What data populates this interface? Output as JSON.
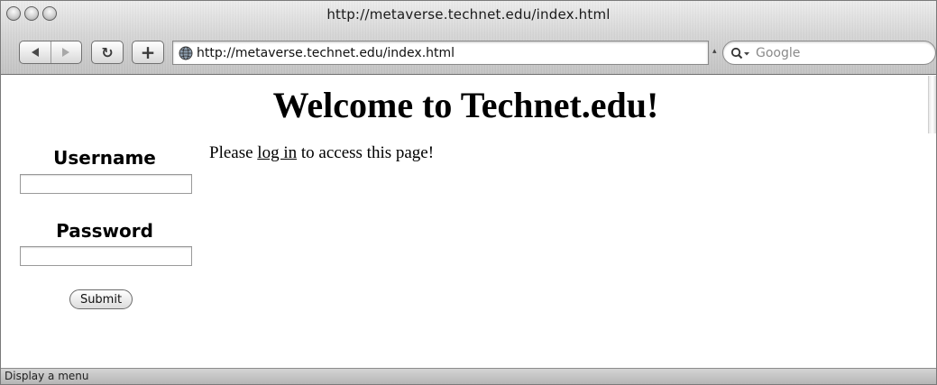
{
  "window": {
    "title": "http://metaverse.technet.edu/index.html"
  },
  "toolbar": {
    "back_icon": "back-arrow-icon",
    "forward_icon": "forward-arrow-icon",
    "reload_glyph": "↻",
    "add_glyph": "+",
    "address_value": "http://metaverse.technet.edu/index.html",
    "address_dropdown_glyph": "▴",
    "search_placeholder": "Google"
  },
  "page": {
    "heading": "Welcome to Technet.edu!",
    "username_label": "Username",
    "password_label": "Password",
    "submit_label": "Submit",
    "message_before": "Please ",
    "message_link": "log in",
    "message_after": " to access this page!"
  },
  "status": {
    "text": "Display a menu"
  }
}
